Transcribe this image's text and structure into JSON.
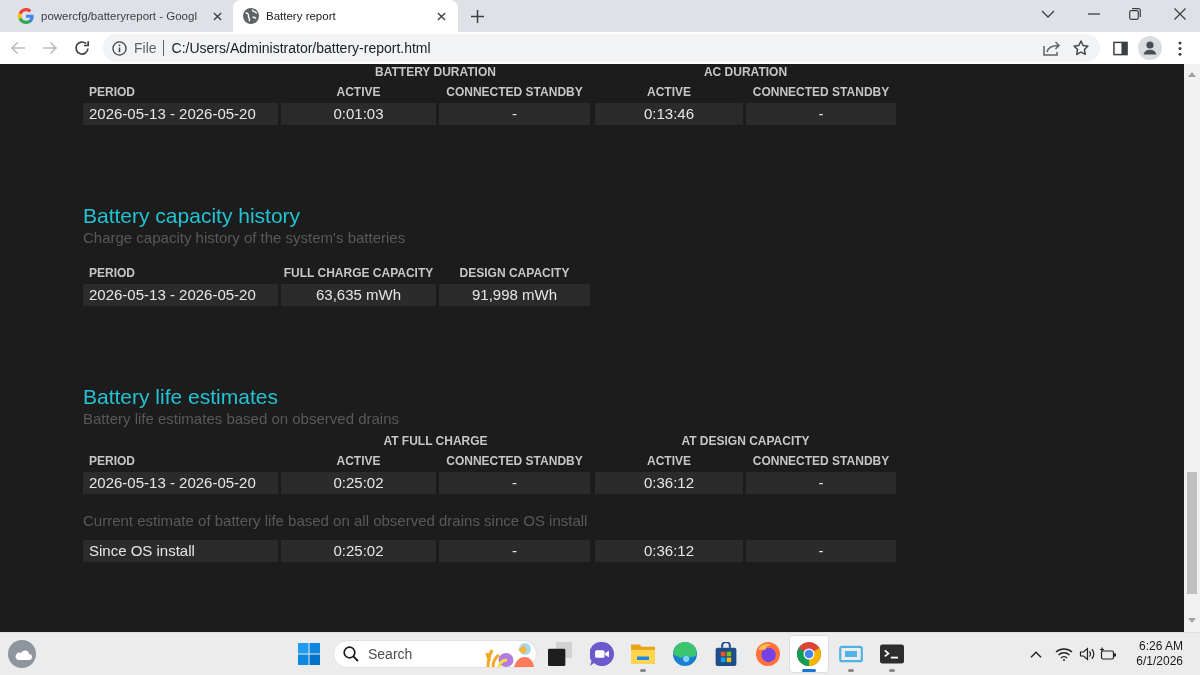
{
  "browser": {
    "tabs": [
      {
        "kind": "search",
        "title": "powercfg/batteryreport - Googl",
        "selected": false
      },
      {
        "kind": "page",
        "title": "Battery report",
        "selected": true
      }
    ],
    "nav": [
      {
        "kind": "back",
        "disabled": true
      },
      {
        "kind": "forward",
        "disabled": true
      },
      {
        "kind": "reload",
        "disabled": false
      }
    ],
    "address": {
      "scheme": "File",
      "url": "C:/Users/Administrator/battery-report.html"
    }
  },
  "report": {
    "sections": [
      {
        "tables": [
          {
            "groups": [
              "BATTERY DURATION",
              "AC DURATION"
            ],
            "columns": [
              "PERIOD",
              "ACTIVE",
              "CONNECTED STANDBY",
              "ACTIVE",
              "CONNECTED STANDBY"
            ],
            "rows": [
              [
                "2026-05-13 - 2026-05-20",
                "0:01:03",
                "-",
                "0:13:46",
                "-"
              ]
            ]
          }
        ]
      },
      {
        "title": "Battery capacity history",
        "subtitle": "Charge capacity history of the system's batteries",
        "tables": [
          {
            "columns": [
              "PERIOD",
              "FULL CHARGE CAPACITY",
              "DESIGN CAPACITY"
            ],
            "rows": [
              [
                "2026-05-13 - 2026-05-20",
                "63,635 mWh",
                "91,998 mWh"
              ]
            ]
          }
        ]
      },
      {
        "title": "Battery life estimates",
        "subtitle": "Battery life estimates based on observed drains",
        "tables": [
          {
            "groups": [
              "AT FULL CHARGE",
              "AT DESIGN CAPACITY"
            ],
            "columns": [
              "PERIOD",
              "ACTIVE",
              "CONNECTED STANDBY",
              "ACTIVE",
              "CONNECTED STANDBY"
            ],
            "rows": [
              [
                "2026-05-13 - 2026-05-20",
                "0:25:02",
                "-",
                "0:36:12",
                "-"
              ]
            ]
          },
          {
            "note": "Current estimate of battery life based on all observed drains since OS install",
            "rows": [
              [
                "Since OS install",
                "0:25:02",
                "-",
                "0:36:12",
                "-"
              ]
            ]
          }
        ]
      }
    ]
  },
  "taskbar": {
    "search": {
      "placeholder": "Search"
    },
    "apps": [
      {
        "kind": "taskview",
        "running": false,
        "selected": false
      },
      {
        "kind": "chat",
        "running": false,
        "selected": false
      },
      {
        "kind": "folder",
        "running": true,
        "selected": false
      },
      {
        "kind": "swirl",
        "running": false,
        "selected": false
      },
      {
        "kind": "store",
        "running": false,
        "selected": false
      },
      {
        "kind": "flame",
        "running": false,
        "selected": false
      },
      {
        "kind": "segmented",
        "running": true,
        "selected": true
      },
      {
        "kind": "screen",
        "running": true,
        "selected": false
      },
      {
        "kind": "terminal",
        "running": true,
        "selected": false
      }
    ],
    "clock": {
      "time": "6:26 AM",
      "date": "6/1/2026"
    }
  }
}
